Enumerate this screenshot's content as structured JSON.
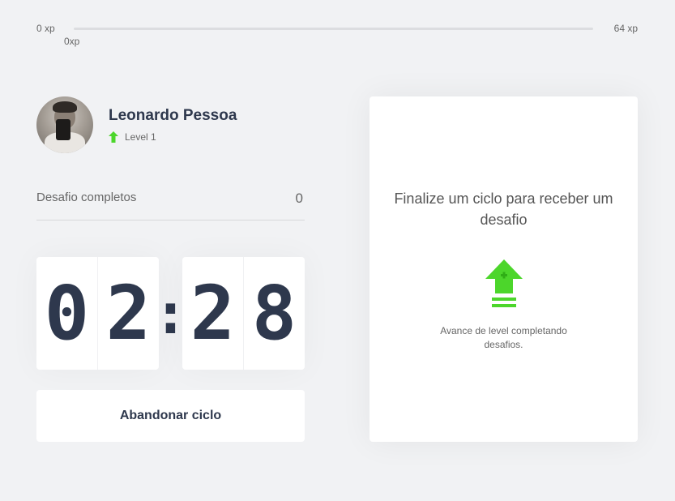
{
  "xp": {
    "min_label": "0 xp",
    "max_label": "64 xp",
    "current_label": "0xp",
    "progress": 0
  },
  "profile": {
    "name": "Leonardo Pessoa",
    "level_label": "Level 1"
  },
  "challenges": {
    "label": "Desafio completos",
    "count": "0"
  },
  "countdown": {
    "min_tens": "0",
    "min_ones": "2",
    "separator": ":",
    "sec_tens": "2",
    "sec_ones": "8"
  },
  "abandon_button": "Abandonar ciclo",
  "challenge_box": {
    "title": "Finalize um ciclo para receber um desafio",
    "description": "Avance de level completando desafios."
  },
  "colors": {
    "accent_green": "#4cd62b",
    "text_dark": "#2e384d",
    "background": "#f1f2f4"
  },
  "icons": [
    "level-up-arrow-icon",
    "level-up-large-icon"
  ]
}
